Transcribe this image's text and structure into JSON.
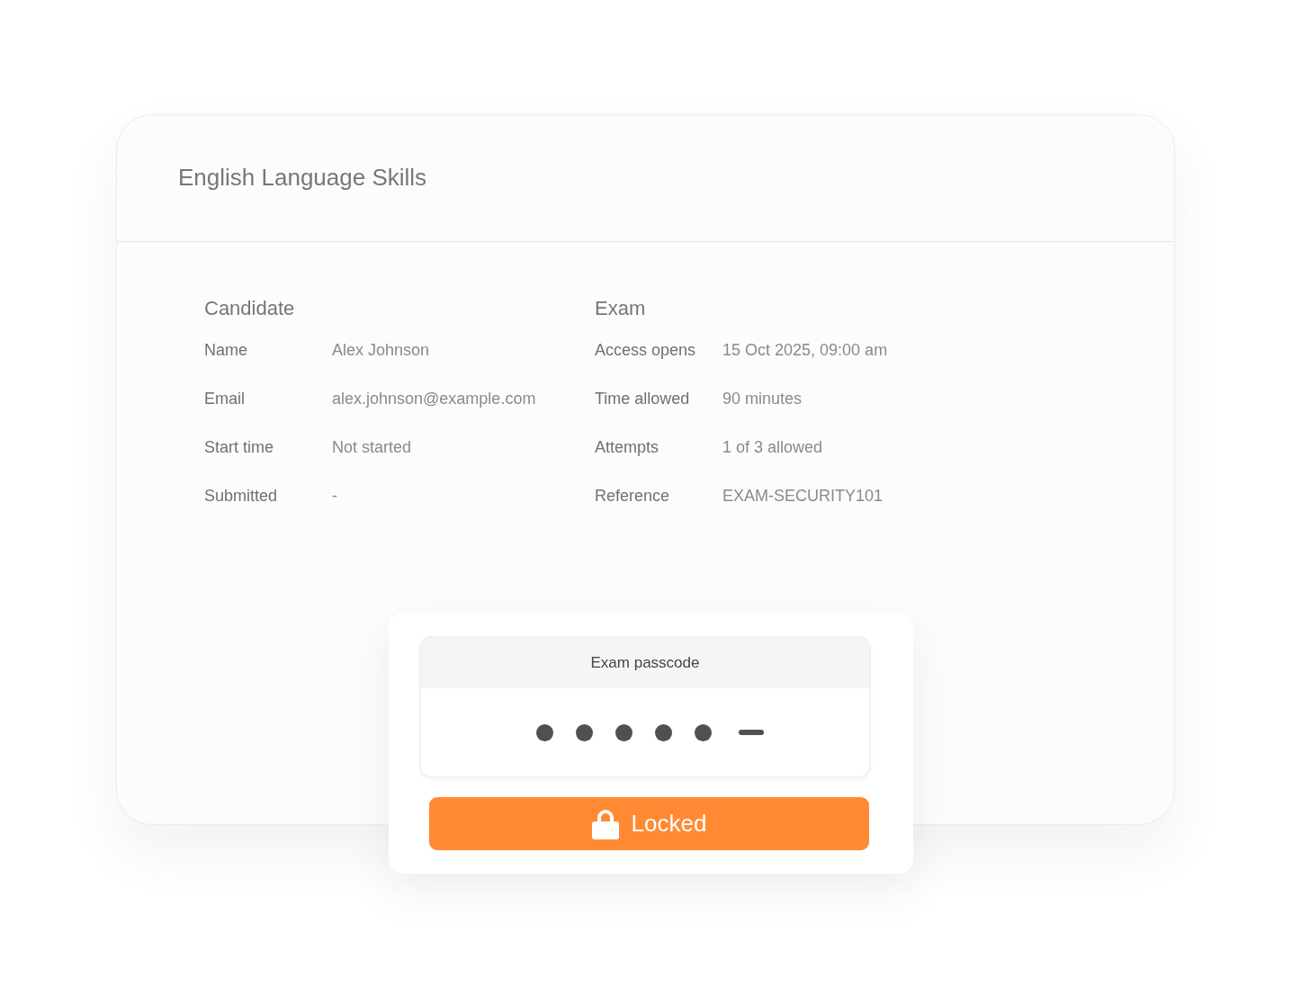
{
  "exam_title": "English Language Skills",
  "sections": [
    {
      "heading": "Candidate",
      "fields": [
        {
          "label": "Name",
          "value": "Alex Johnson"
        },
        {
          "label": "Email",
          "value": "alex.johnson@example.com"
        },
        {
          "label": "Start time",
          "value": "Not started"
        },
        {
          "label": "Submitted",
          "value": "-"
        }
      ]
    },
    {
      "heading": "Exam",
      "fields": [
        {
          "label": "Access opens",
          "value": "15 Oct 2025, 09:00 am"
        },
        {
          "label": "Time allowed",
          "value": "90 minutes"
        },
        {
          "label": "Attempts",
          "value": "1 of 3 allowed"
        },
        {
          "label": "Reference",
          "value": "EXAM-SECURITY101"
        }
      ]
    }
  ],
  "passcode": {
    "label": "Exam passcode",
    "slots": [
      {
        "filled": true
      },
      {
        "filled": true
      },
      {
        "filled": true
      },
      {
        "filled": true
      },
      {
        "filled": true
      },
      {
        "filled": false
      }
    ]
  },
  "lock_button": {
    "label": "Locked",
    "locked": true
  }
}
